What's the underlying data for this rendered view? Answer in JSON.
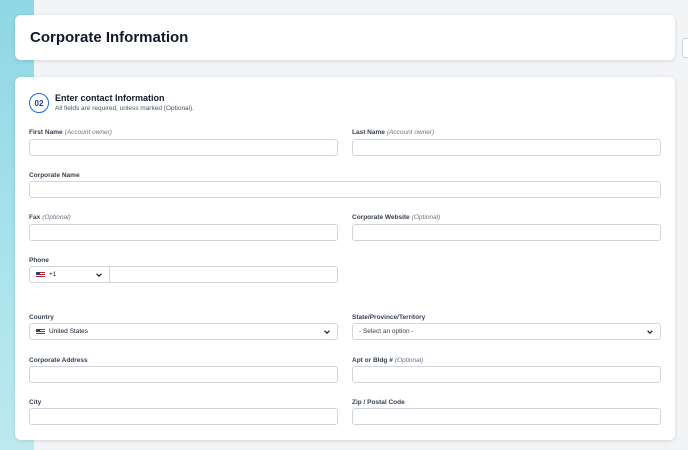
{
  "page": {
    "title": "Corporate Information"
  },
  "step": {
    "number": "02",
    "title": "Enter contact Information",
    "subtitle": "All fields are required, unless marked (Optional)."
  },
  "fields": {
    "first_name": {
      "label": "First Name",
      "note": "(Account owner)",
      "value": ""
    },
    "last_name": {
      "label": "Last Name",
      "note": "(Account owner)",
      "value": ""
    },
    "corporate_name": {
      "label": "Corporate Name",
      "value": ""
    },
    "fax": {
      "label": "Fax",
      "note": "(Optional)",
      "value": ""
    },
    "website": {
      "label": "Corporate Website",
      "note": "(Optional)",
      "value": ""
    },
    "phone": {
      "label": "Phone",
      "country_code": "+1",
      "flag": "us-flag-icon",
      "value": ""
    },
    "country": {
      "label": "Country",
      "selected": "United States",
      "flag": "us-flag-icon"
    },
    "state": {
      "label": "State/Province/Territory",
      "selected": "- Select an option -"
    },
    "address": {
      "label": "Corporate Address",
      "value": ""
    },
    "apt": {
      "label": "Apt or Bldg #",
      "note": "(Optional)",
      "value": ""
    },
    "city": {
      "label": "City",
      "value": ""
    },
    "zip": {
      "label": "Zip / Postal Code",
      "value": ""
    }
  },
  "colors": {
    "accent": "#2563eb",
    "sidebar": "#a7e3ec",
    "border": "#d1d5db"
  }
}
